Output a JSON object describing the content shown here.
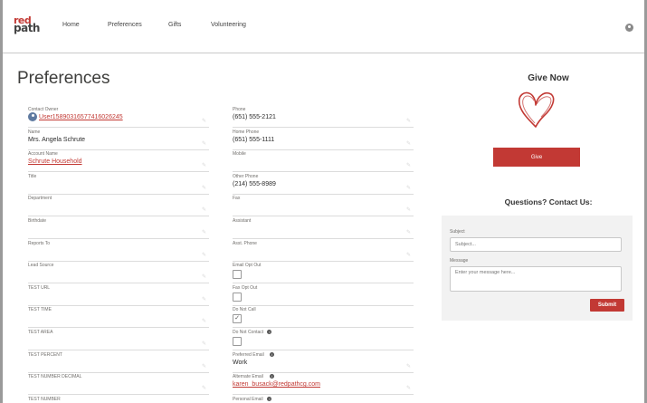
{
  "brand": {
    "logo_top": "red",
    "logo_bottom": "path"
  },
  "nav": {
    "items": [
      "Home",
      "Preferences",
      "Gifts",
      "Volunteering"
    ]
  },
  "page": {
    "title": "Preferences"
  },
  "left_fields": [
    {
      "label": "Contact Owner",
      "value": "User15890316577416026245",
      "link": true
    },
    {
      "label": "Name",
      "value": "Mrs. Angela Schrute",
      "link": false
    },
    {
      "label": "Account Name",
      "value": "Schrute Household",
      "link": true
    },
    {
      "label": "Title",
      "value": "",
      "link": false
    },
    {
      "label": "Department",
      "value": "",
      "link": false
    },
    {
      "label": "Birthdate",
      "value": "",
      "link": false
    },
    {
      "label": "Reports To",
      "value": "",
      "link": false
    },
    {
      "label": "Lead Source",
      "value": "",
      "link": false
    },
    {
      "label": "TEST URL",
      "value": "",
      "link": false
    },
    {
      "label": "TEST TIME",
      "value": "",
      "link": false
    },
    {
      "label": "TEST AREA",
      "value": "",
      "link": false
    },
    {
      "label": "TEST PERCENT",
      "value": "",
      "link": false
    },
    {
      "label": "TEST NUMBER DECIMAL",
      "value": "",
      "link": false
    },
    {
      "label": "TEST NUMBER",
      "value": "",
      "link": false
    }
  ],
  "right_fields": [
    {
      "label": "Phone",
      "value": "(651) 555-2121"
    },
    {
      "label": "Home Phone",
      "value": "(651) 555-1111"
    },
    {
      "label": "Mobile",
      "value": ""
    },
    {
      "label": "Other Phone",
      "value": "(214) 555-8989"
    },
    {
      "label": "Fax",
      "value": ""
    },
    {
      "label": "Assistant",
      "value": ""
    },
    {
      "label": "Asst. Phone",
      "value": ""
    },
    {
      "label": "Email Opt Out",
      "checkbox": true,
      "checked": false
    },
    {
      "label": "Fax Opt Out",
      "checkbox": true,
      "checked": false
    },
    {
      "label": "Do Not Call",
      "checkbox": true,
      "checked": true
    },
    {
      "label": "Do Not Contact",
      "checkbox": true,
      "checked": false,
      "info": true
    },
    {
      "label": "Preferred Email",
      "value": "Work",
      "info": true
    },
    {
      "label": "Alternate Email",
      "value": "karen_busack@redpathcg.com",
      "link": true,
      "info": true
    },
    {
      "label": "Personal Email",
      "value": "",
      "info": true
    }
  ],
  "give": {
    "title": "Give Now",
    "button": "Give"
  },
  "contact": {
    "title": "Questions? Contact Us:",
    "subject_label": "Subject",
    "subject_placeholder": "Subject...",
    "message_label": "Message",
    "message_placeholder": "Enter your message here...",
    "submit": "Submit"
  },
  "colors": {
    "accent": "#c23934"
  }
}
